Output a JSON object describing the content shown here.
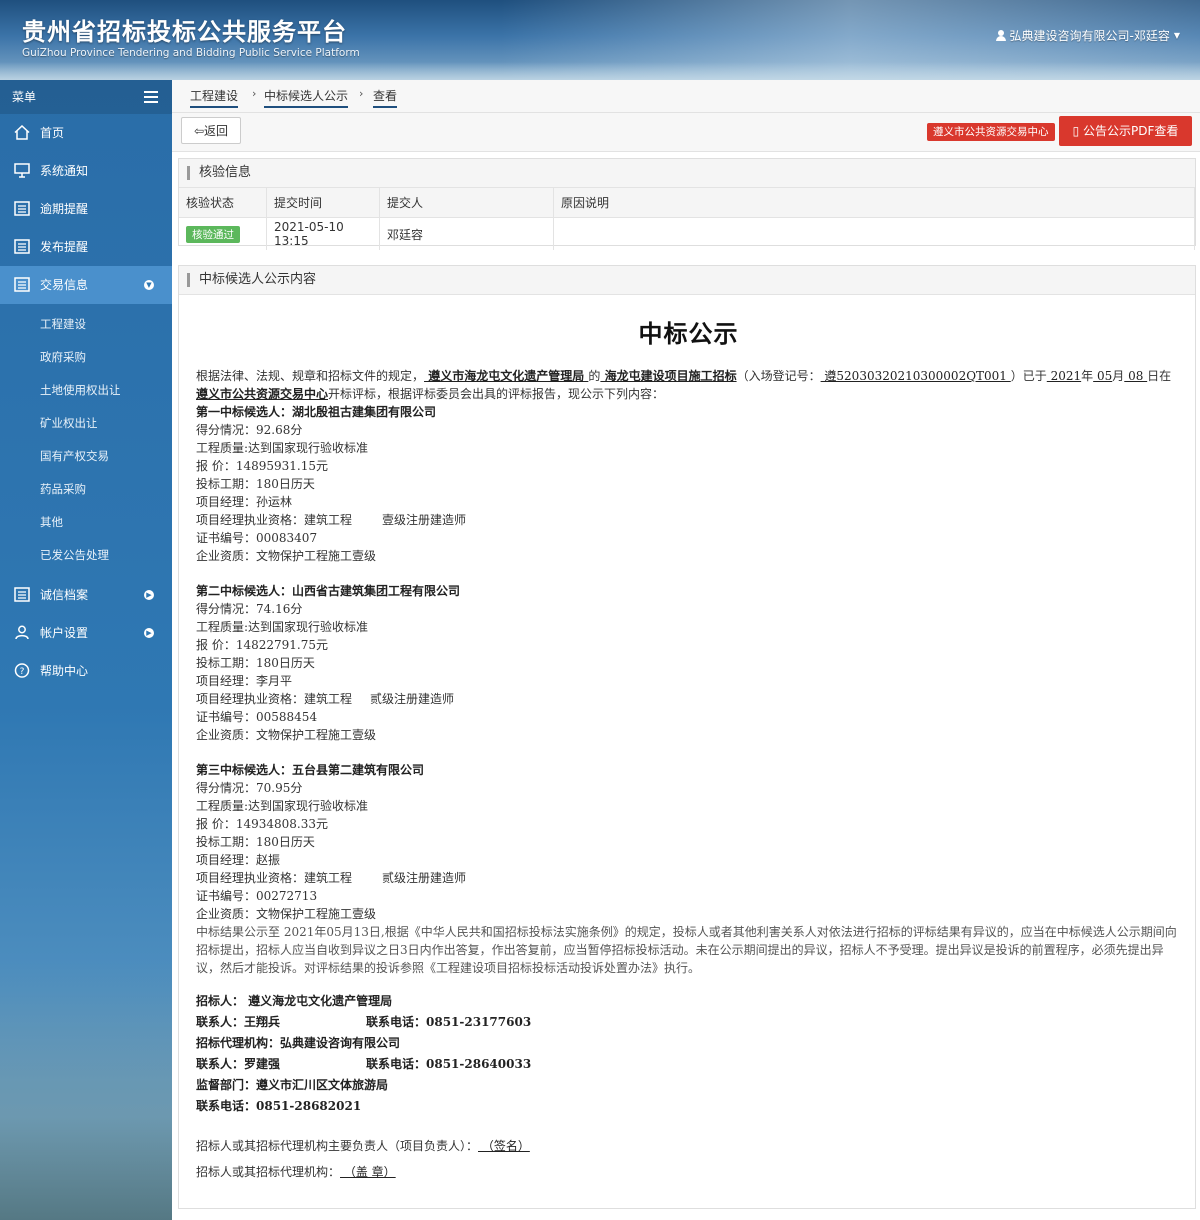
{
  "header": {
    "title": "贵州省招标投标公共服务平台",
    "subtitle": "GuiZhou Province Tendering and Bidding Public Service Platform",
    "user": "弘典建设咨询有限公司-邓廷容"
  },
  "sidebar": {
    "menu_label": "菜单",
    "items": [
      {
        "label": "首页"
      },
      {
        "label": "系统通知"
      },
      {
        "label": "逾期提醒"
      },
      {
        "label": "发布提醒"
      },
      {
        "label": "交易信息"
      }
    ],
    "sub_items": [
      "工程建设",
      "政府采购",
      "土地使用权出让",
      "矿业权出让",
      "国有产权交易",
      "药品采购",
      "其他",
      "已发公告处理"
    ],
    "bottom_items": [
      {
        "label": "诚信档案"
      },
      {
        "label": "帐户设置"
      },
      {
        "label": "帮助中心"
      }
    ]
  },
  "breadcrumb": [
    "工程建设",
    "中标候选人公示",
    "查看"
  ],
  "toolbar": {
    "back": "返回",
    "center": "遵义市公共资源交易中心",
    "pdf": "公告公示PDF查看"
  },
  "verify": {
    "title": "核验信息",
    "headers": [
      "核验状态",
      "提交时间",
      "提交人",
      "原因说明"
    ],
    "row": {
      "status": "核验通过",
      "time": "2021-05-10 13:15",
      "submitter": "邓廷容",
      "reason": ""
    }
  },
  "content_panel": {
    "title": "中标候选人公示内容"
  },
  "doc": {
    "title": "中标公示",
    "intro": {
      "p1": "根据法律、法规、规章和招标文件的规定，",
      "tenderer": "  遵义市海龙屯文化遗产管理局   ",
      "p2": "的",
      "project": "  海龙屯建设项目施工招标",
      "p3": "（入场登记号：",
      "reg": "  遵52030320210300002QT001  ",
      "p4": "）已于",
      "year": "  2021",
      "p5": "年",
      "month": "  05",
      "p6": "月",
      "day": "  08  ",
      "p7": "日在",
      "place": "  遵义市公共资源交易中心",
      "p8": "开标评标，根据评标委员会出具的评标报告，现公示下列内容："
    },
    "candidates": [
      {
        "name": "第一中标候选人：湖北殷祖古建集团有限公司",
        "score": "得分情况：92.68分",
        "quality": "工程质量:达到国家现行验收标准",
        "price": "报 价：14895931.15元",
        "period": "投标工期：180日历天",
        "manager": "项目经理：孙运林",
        "qual_a": "项目经理执业资格：建筑工程",
        "qual_b": "壹级注册建造师",
        "cert": "证书编号：00083407",
        "company_qual": "企业资质：文物保护工程施工壹级"
      },
      {
        "name": "第二中标候选人：山西省古建筑集团工程有限公司",
        "score": "得分情况：74.16分",
        "quality": "工程质量:达到国家现行验收标准",
        "price": "报 价：14822791.75元",
        "period": "投标工期：180日历天",
        "manager": "项目经理：李月平",
        "qual_a": "项目经理执业资格：建筑工程",
        "qual_b": "贰级注册建造师",
        "cert": "证书编号：00588454",
        "company_qual": "企业资质：文物保护工程施工壹级"
      },
      {
        "name": "第三中标候选人：五台县第二建筑有限公司",
        "score": "得分情况：70.95分",
        "quality": "工程质量:达到国家现行验收标准",
        "price": "报 价：14934808.33元",
        "period": "投标工期：180日历天",
        "manager": "项目经理：赵振",
        "qual_a": "项目经理执业资格：建筑工程",
        "qual_b": "贰级注册建造师",
        "cert": "证书编号：00272713",
        "company_qual": "企业资质：文物保护工程施工壹级"
      }
    ],
    "notice": "中标结果公示至 2021年05月13日,根据《中华人民共和国招标投标法实施条例》的规定，投标人或者其他利害关系人对依法进行招标的评标结果有异议的，应当在中标候选人公示期间向招标提出，招标人应当自收到异议之日3日内作出答复，作出答复前，应当暂停招标投标活动。未在公示期间提出的异议，招标人不予受理。提出异议是投诉的前置程序，必须先提出异议，然后才能投诉。对评标结果的投诉参照《工程建设项目招标投标活动投诉处置办法》执行。",
    "contacts": {
      "tenderer": "招标人：    遵义海龙屯文化遗产管理局",
      "contact1": "联系人：王翔兵",
      "phone1": "联系电话：0851-23177603",
      "agency": "招标代理机构：弘典建设咨询有限公司",
      "contact2": "联系人：罗建强",
      "phone2": "联系电话：0851-28640033",
      "supervisor": "监督部门：遵义市汇川区文体旅游局",
      "phone3": "联系电话：0851-28682021"
    },
    "sign1_label": "招标人或其招标代理机构主要负责人（项目负责人）：",
    "sign1_value": "           （签名）",
    "sign2_label": "招标人或其招标代理机构：",
    "sign2_value": "           （盖 章）"
  }
}
